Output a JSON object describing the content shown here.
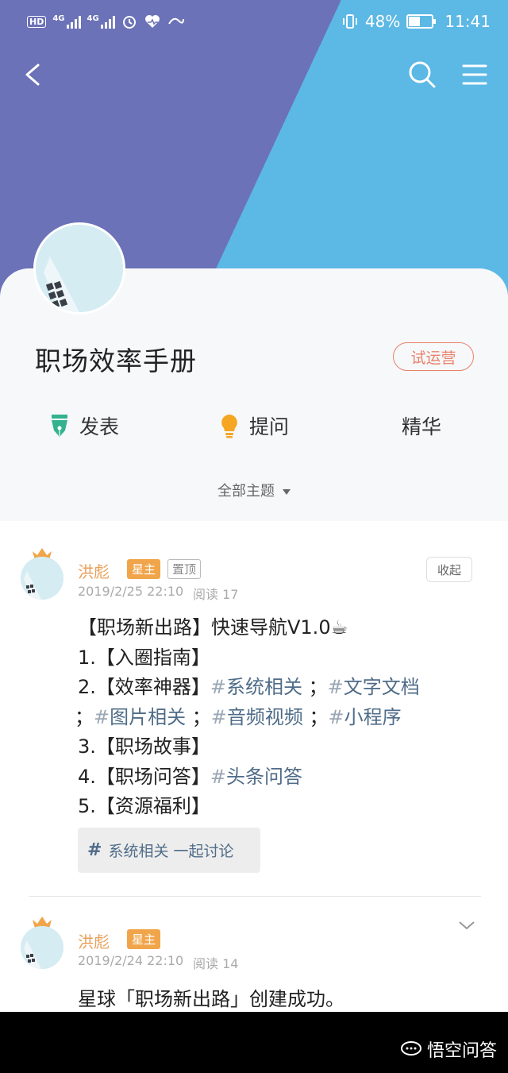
{
  "status_bar": {
    "left_labels": [
      "HD",
      "4G",
      "4G"
    ],
    "battery": "48%",
    "time": "11:41"
  },
  "circle": {
    "title": "职场效率手册",
    "badge": "试运营"
  },
  "actions": {
    "post": "发表",
    "ask": "提问",
    "featured": "精华"
  },
  "filter": {
    "label": "全部主题"
  },
  "posts": [
    {
      "author": "洪彪",
      "owner_tag": "星主",
      "pin_tag": "置顶",
      "date": "2019/2/25 22:10",
      "reads": "阅读 17",
      "collapse": "收起",
      "lines": {
        "l1": "【职场新出路】快速导航V1.0☕",
        "l2": "1.【入圈指南】",
        "l3_prefix": "2.【效率神器】",
        "tag_system": "系统相关",
        "tag_docs": "文字文档",
        "tag_images": "图片相关",
        "tag_audio": "音频视频",
        "tag_mini": "小程序",
        "l5": "3.【职场故事】",
        "l6_prefix": "4.【职场问答】",
        "tag_toutiao": "头条问答",
        "l7": "5.【资源福利】"
      },
      "topic_chip": "系统相关 一起讨论"
    },
    {
      "author": "洪彪",
      "owner_tag": "星主",
      "date": "2019/2/24 22:10",
      "reads": "阅读 14",
      "text": "星球「职场新出路」创建成功。"
    }
  ],
  "watermark": "悟空问答"
}
